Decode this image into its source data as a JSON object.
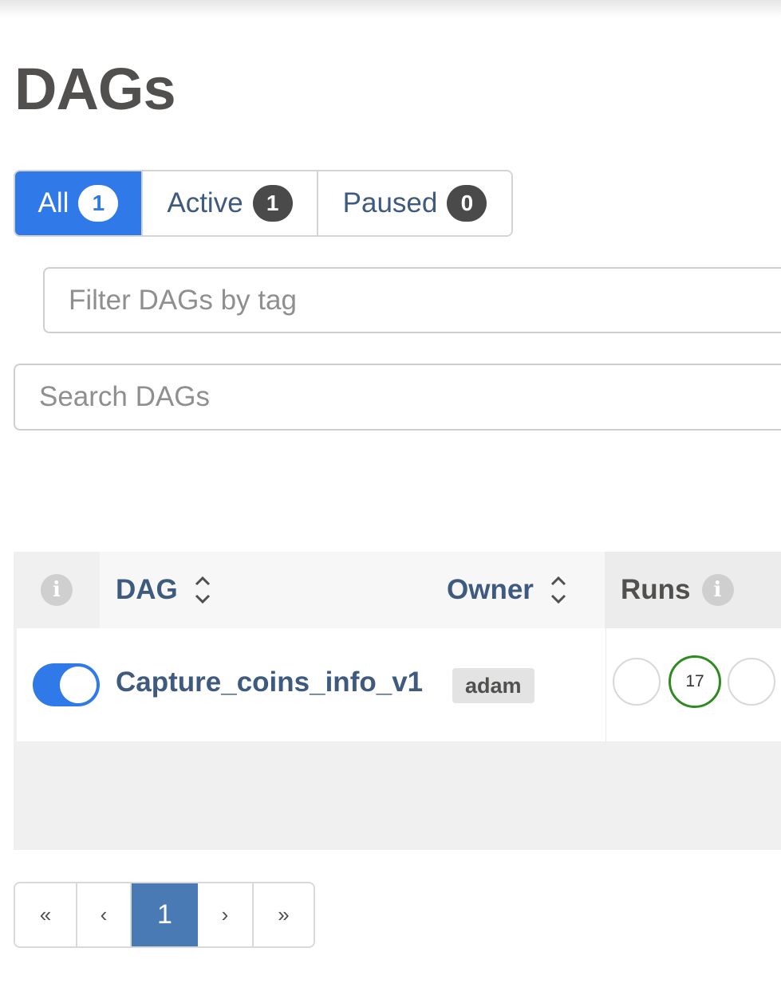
{
  "page": {
    "title": "DAGs"
  },
  "status_filter": {
    "all": {
      "label": "All",
      "count": "1"
    },
    "active": {
      "label": "Active",
      "count": "1"
    },
    "paused": {
      "label": "Paused",
      "count": "0"
    }
  },
  "tag_filter": {
    "placeholder": "Filter DAGs by tag"
  },
  "search": {
    "placeholder": "Search DAGs"
  },
  "table": {
    "columns": {
      "info": "i",
      "dag": "DAG",
      "owner": "Owner",
      "runs": "Runs"
    },
    "rows": [
      {
        "toggle_on": true,
        "dag_id": "Capture_coins_info_v1",
        "owner": "adam",
        "runs": [
          "",
          "17",
          ""
        ]
      }
    ]
  },
  "colors": {
    "primary": "#2f79e8",
    "link": "#3e5a7f",
    "success": "#2e8b20",
    "pagination_active": "#4a7ab4"
  },
  "pagination": {
    "first": "«",
    "prev": "‹",
    "current": "1",
    "next": "›",
    "last": "»"
  }
}
